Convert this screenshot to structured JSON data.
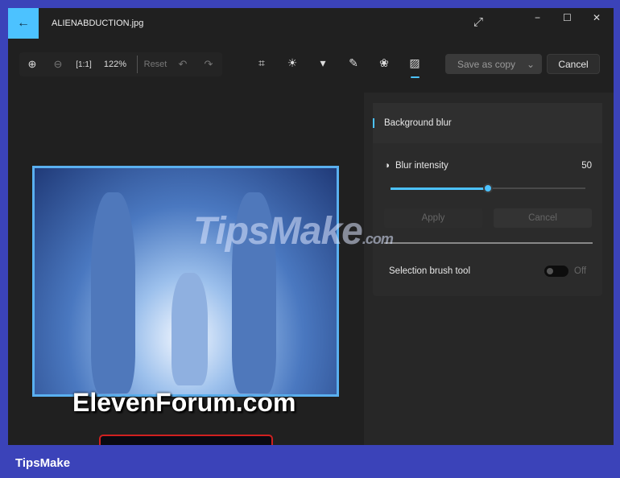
{
  "window": {
    "title": "ALIENABDUCTION.jpg",
    "back_icon": "arrow-left-icon",
    "minimize": "−",
    "maximize": "☐",
    "close": "✕",
    "expand_icon": "⤢"
  },
  "toolbar": {
    "zoom_level": "122%",
    "reset_label": "Reset"
  },
  "header": {
    "save_label": "Save as copy",
    "cancel_label": "Cancel"
  },
  "image": {
    "watermark_text": "ElevenForum.com",
    "overlay_watermark": "TipsMake",
    ".com": ".com"
  },
  "panel": {
    "section_title": "Background blur",
    "blur_label": "Blur intensity",
    "blur_value": "50",
    "blur_percent": 50,
    "apply_label": "Apply",
    "cancel_label": "Cancel",
    "brush_label": "Selection brush tool",
    "brush_state": "Off"
  },
  "colors": {
    "accent": "#4cc2ff",
    "frame": "#3b43b9"
  },
  "footer": {
    "brand": "TipsMake"
  }
}
